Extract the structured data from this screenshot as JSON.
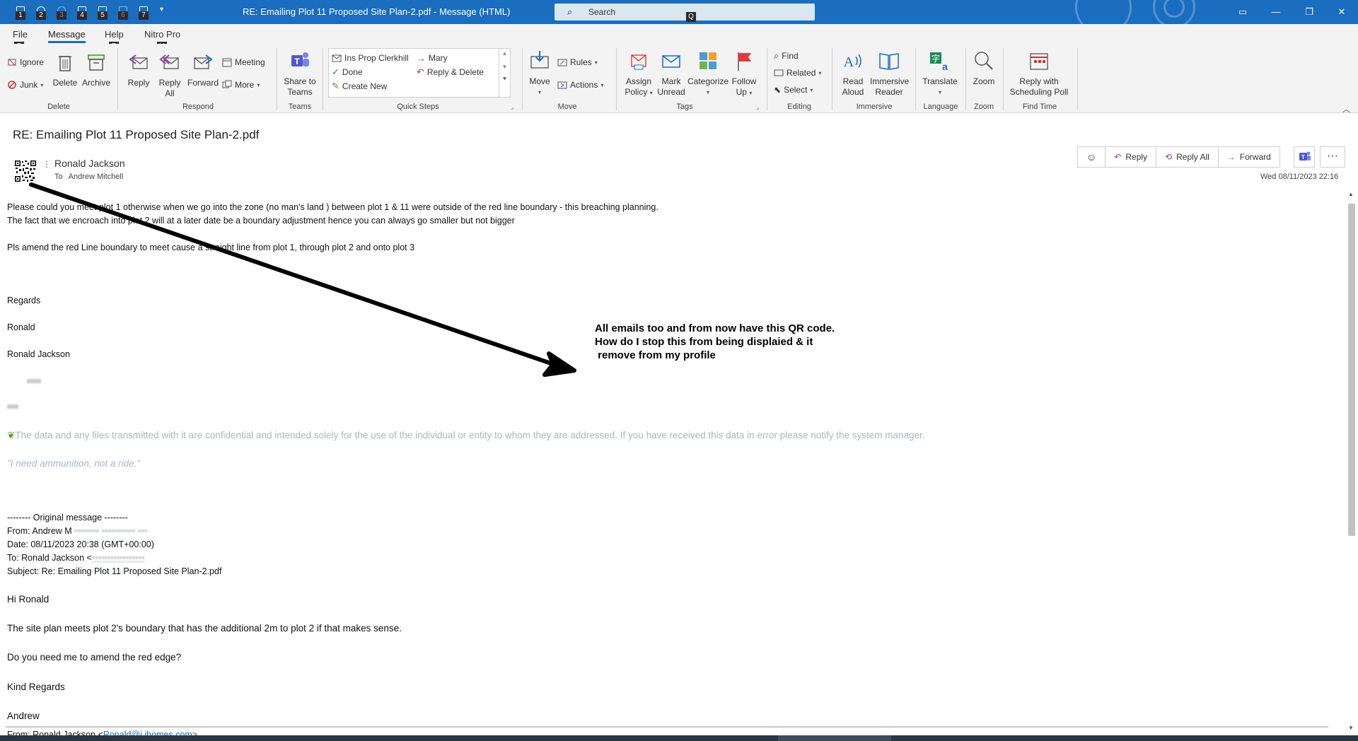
{
  "window": {
    "title": "RE: Emailing Plot 11 Proposed Site Plan-2.pdf  -  Message (HTML)",
    "search_placeholder": "Search",
    "search_key": "Q",
    "qa_keys": [
      "1",
      "2",
      "3",
      "4",
      "5",
      "6",
      "7"
    ]
  },
  "menu": {
    "tabs": [
      {
        "label": "File",
        "key": "F"
      },
      {
        "label": "Message",
        "key": "H"
      },
      {
        "label": "Help",
        "key": "E"
      },
      {
        "label": "Nitro Pro",
        "key": "Y"
      }
    ]
  },
  "ribbon": {
    "groups": {
      "delete": "Delete",
      "respond": "Respond",
      "teams": "Teams",
      "quick_steps": "Quick Steps",
      "move": "Move",
      "tags": "Tags",
      "editing": "Editing",
      "immersive": "Immersive",
      "language": "Language",
      "zoom": "Zoom",
      "find_time": "Find Time"
    },
    "ignore": "Ignore",
    "junk": "Junk",
    "delete": "Delete",
    "archive": "Archive",
    "reply": "Reply",
    "reply_all_1": "Reply",
    "reply_all_2": "All",
    "forward": "Forward",
    "meeting": "Meeting",
    "more": "More",
    "share_teams_1": "Share to",
    "share_teams_2": "Teams",
    "qs_ins": "Ins Prop Clerkhill",
    "qs_mary": "Mary",
    "qs_done": "Done",
    "qs_reply_delete": "Reply & Delete",
    "qs_create": "Create New",
    "move": "Move",
    "rules": "Rules",
    "actions": "Actions",
    "assign_1": "Assign",
    "assign_2": "Policy",
    "mark_1": "Mark",
    "mark_2": "Unread",
    "categorize": "Categorize",
    "follow_1": "Follow",
    "follow_2": "Up",
    "find": "Find",
    "related": "Related",
    "select": "Select",
    "read_1": "Read",
    "read_2": "Aloud",
    "immersive_1": "Immersive",
    "immersive_2": "Reader",
    "translate": "Translate",
    "zoom": "Zoom",
    "poll_1": "Reply with",
    "poll_2": "Scheduling Poll"
  },
  "message": {
    "subject": "RE: Emailing Plot 11 Proposed Site Plan-2.pdf",
    "sender": "Ronald Jackson",
    "to_label": "To",
    "to_name": "Andrew Mitchell",
    "date": "Wed 08/11/2023 22:16",
    "actions": {
      "reply": "Reply",
      "reply_all": "Reply All",
      "forward": "Forward",
      "more": "···"
    }
  },
  "body": {
    "l1": "Please could you meet plot 1 otherwise when we go into the zone (no man's land ) between plot 1 & 11 were outside of the red line boundary - this breaching planning.",
    "l2": "The fact that we encroach into plot 2 will at a later date be a boundary adjustment hence you can always go smaller but not bigger",
    "l3": "Pls amend the red Line boundary to meet cause a straight line from plot 1, through plot 2 and onto plot 3",
    "regards": "Regards",
    "ronald": "Ronald",
    "ronald_jackson": "Ronald Jackson",
    "confidential": "The data and any files transmitted with it are confidential and intended solely for the use of the individual or entity to whom they are addressed. If you have received this data in error please notify the system manager.",
    "quote": "\"I need ammunition, not a ride.\"",
    "orig_header": "-------- Original message --------",
    "from": "From: Andrew M",
    "date": "Date: 08/11/2023 20:38 (GMT+00:00)",
    "to": "To: Ronald Jackson <",
    "subject": "Subject: Re: Emailing Plot 11 Proposed Site Plan-2.pdf",
    "hi": "Hi Ronald",
    "site_plan": "The site plan meets plot 2's boundary that has the additional 2m to plot 2 if that makes sense.",
    "amend": "Do you need me to amend the red edge?",
    "kind": "Kind Regards",
    "andrew": "Andrew",
    "from2": "From: Ronald Jackson <",
    "from2_link": "Ronald@j.jhomes.com>"
  },
  "annotation": "All emails too and from now have this QR code.\nHow do I stop this from being displaied & it\n remove from my profile",
  "colors": {
    "accent": "#1a6dbf",
    "confidential": "#a8b8c8"
  }
}
